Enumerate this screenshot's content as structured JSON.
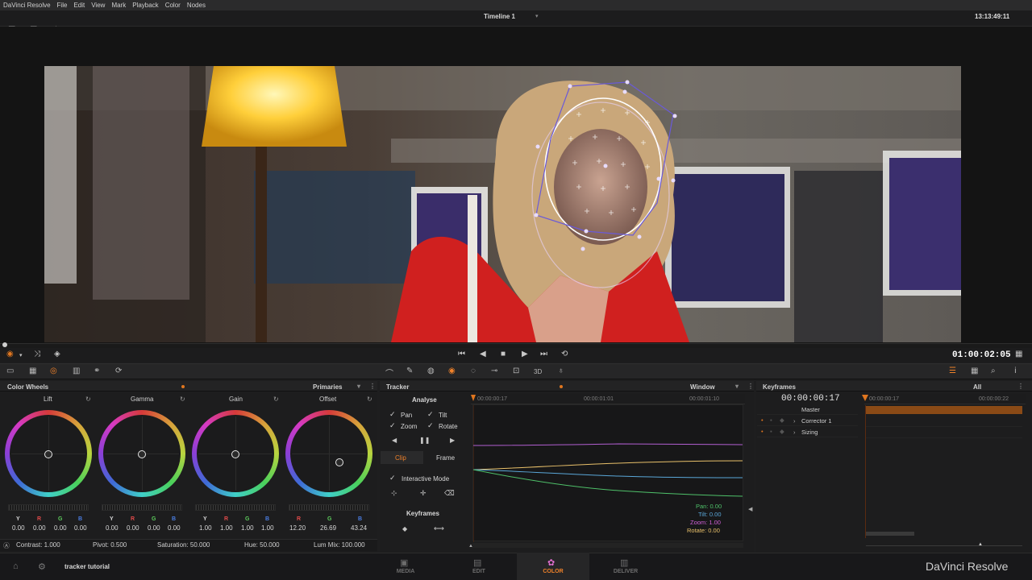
{
  "menu": {
    "app": "DaVinci Resolve",
    "items": [
      "File",
      "Edit",
      "View",
      "Mark",
      "Playback",
      "Color",
      "Nodes"
    ]
  },
  "viewer": {
    "timeline_name": "Timeline 1",
    "clock": "13:13:49:11",
    "timecode": "01:00:02:05"
  },
  "color_wheels": {
    "title": "Color Wheels",
    "mode": "Primaries",
    "wheels": [
      {
        "name": "Lift",
        "values": [
          "0.00",
          "0.00",
          "0.00",
          "0.00"
        ]
      },
      {
        "name": "Gamma",
        "values": [
          "0.00",
          "0.00",
          "0.00",
          "0.00"
        ]
      },
      {
        "name": "Gain",
        "values": [
          "1.00",
          "1.00",
          "1.00",
          "1.00"
        ]
      },
      {
        "name": "Offset",
        "values": [
          "12.20",
          "26.69",
          "43.24"
        ]
      }
    ],
    "channels": [
      "Y",
      "R",
      "G",
      "B"
    ],
    "offset_channels": [
      "R",
      "G",
      "B"
    ],
    "footer": {
      "contrast": "Contrast: 1.000",
      "pivot": "Pivot: 0.500",
      "saturation": "Saturation: 50.000",
      "hue": "Hue: 50.000",
      "lum_mix": "Lum Mix: 100.000"
    }
  },
  "tracker": {
    "title": "Tracker",
    "window_mode": "Window",
    "analyse": "Analyse",
    "options": {
      "pan": "Pan",
      "tilt": "Tilt",
      "zoom": "Zoom",
      "rotate": "Rotate"
    },
    "tabs": {
      "clip": "Clip",
      "frame": "Frame"
    },
    "interactive_mode": "Interactive Mode",
    "keyframes": "Keyframes",
    "ruler": [
      "00:00:00:17",
      "00:00:01:01",
      "00:00:01:10"
    ],
    "readout": {
      "pan": "Pan: 0.00",
      "tilt": "Tilt: 0.00",
      "zoom": "Zoom: 1.00",
      "rotate": "Rotate: 0.00"
    }
  },
  "keyframes": {
    "title": "Keyframes",
    "filter": "All",
    "timecode": "00:00:00:17",
    "ruler": [
      "00:00:00:17",
      "00:00:00:22"
    ],
    "rows": {
      "master": "Master",
      "corrector": "Corrector 1",
      "sizing": "Sizing"
    }
  },
  "bottom_nav": {
    "project": "tracker tutorial",
    "pages": [
      "MEDIA",
      "EDIT",
      "COLOR",
      "DELIVER"
    ],
    "brand": "DaVinci Resolve"
  },
  "colors": {
    "accent": "#f0822a",
    "pan_line": "#b25fd1",
    "tilt_line": "#5aa7d8",
    "zoom_line": "#e8c06a",
    "rotate_line": "#4fc26a"
  }
}
